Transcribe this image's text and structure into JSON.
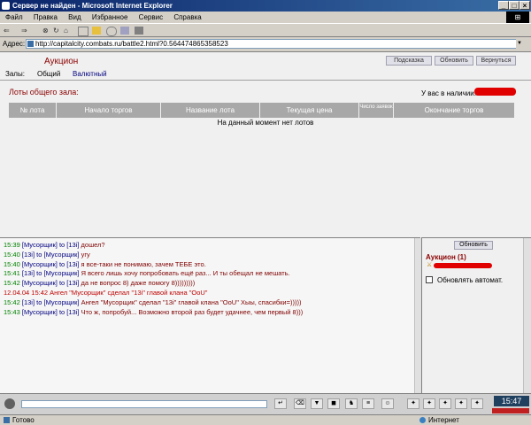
{
  "window": {
    "title": "Сервер не найден - Microsoft Internet Explorer"
  },
  "menu": [
    "Файл",
    "Правка",
    "Вид",
    "Избранное",
    "Сервис",
    "Справка"
  ],
  "toolbar": {
    "back": "⇐",
    "forward": "⇒",
    "stop": "⊗",
    "refresh": "↻",
    "home": "⌂"
  },
  "address": {
    "label": "Адрес:",
    "url": "http://capitalcity.combats.ru/battle2.html?0.564474865358523"
  },
  "auction": {
    "title": "Аукцион",
    "buttons": {
      "hint": "Подсказка",
      "refresh": "Обновить",
      "back": "Вернуться"
    },
    "halls_label": "Залы:",
    "hall_general": "Общий",
    "hall_currency": "Валютный",
    "lots_title": "Лоты общего зала:",
    "have_label": "У вас в наличии:",
    "columns": [
      "№ лота",
      "Начало торгов",
      "Название лота",
      "Текущая цена",
      "Число заявок",
      "Окончание торгов"
    ],
    "empty": "На данный момент нет лотов"
  },
  "chat": {
    "lines": [
      {
        "time": "15:39",
        "user": "[Мусорщик]",
        "to": " to [13i] ",
        "msg": "дошел?",
        "color": "#800000"
      },
      {
        "time": "15:40",
        "user": "[13i]",
        "to": " to [Мусорщик] ",
        "msg": "угу",
        "color": "#800000"
      },
      {
        "time": "15:40",
        "user": "[Мусорщик]",
        "to": " to [13i] ",
        "msg": "я все-таки не понимаю, зачем ТЕБЕ это.",
        "color": "#800000"
      },
      {
        "time": "15:41",
        "user": "[13i]",
        "to": " to [Мусорщик] ",
        "msg": "Я всего лишь хочу попробовать ещё раз... И ты обещал не мешать.",
        "color": "#800000"
      },
      {
        "time": "15:42",
        "user": "[Мусорщик]",
        "to": " to [13i] ",
        "msg": "да не вопрос 8) даже помогу 8)))))))))",
        "color": "#800000"
      },
      {
        "time": "12.04.04 15:42",
        "user": "",
        "to": "",
        "msg": "Ангел \"Мусорщик\" сделал \"13i\" главой клана \"OoU\"",
        "color": "#c00000"
      },
      {
        "time": "15:42",
        "user": "[13i]",
        "to": " to [Мусорщик] ",
        "msg": "Ангел \"Мусорщик\" сделал \"13i\" главой клана \"OoU\" Хыы, спасибки=)))))",
        "color": "#800000"
      },
      {
        "time": "15:43",
        "user": "[Мусорщик]",
        "to": " to [13i] ",
        "msg": "Что ж, попробуй... Возможно второй раз будет удачнее, чем первый 8)))",
        "color": "#800000"
      }
    ]
  },
  "side": {
    "refresh": "Обновить",
    "title": "Аукцион (1)",
    "auto_label": "Обновлять автомат."
  },
  "inputbar": {
    "clock": "15:47"
  },
  "status": {
    "left": "Готово",
    "right": "Интернет"
  }
}
